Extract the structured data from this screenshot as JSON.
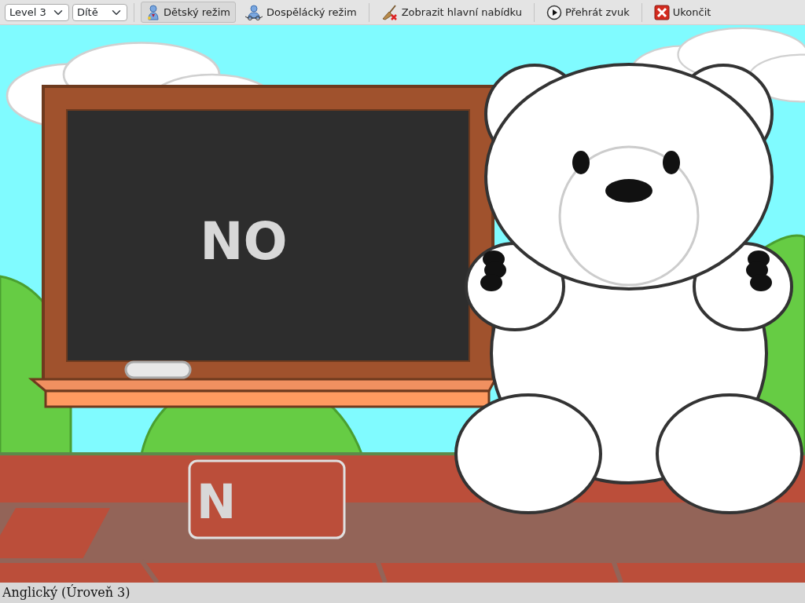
{
  "toolbar": {
    "level_select": "Level 3",
    "mode_select": "Dítě",
    "buttons": [
      {
        "label": "Dětský režim",
        "kind": "child",
        "selected": true
      },
      {
        "label": "Dospělácký režim",
        "kind": "adult",
        "selected": false
      },
      {
        "label": "Zobrazit hlavní nabídku",
        "kind": "menu",
        "selected": false
      },
      {
        "label": "Přehrát zvuk",
        "kind": "play",
        "selected": false
      },
      {
        "label": "Ukončit",
        "kind": "quit",
        "selected": false
      }
    ]
  },
  "board": {
    "word": "NO"
  },
  "answer_tile": {
    "text": "N"
  },
  "status_bar": "Anglický (Úroveň 3)"
}
